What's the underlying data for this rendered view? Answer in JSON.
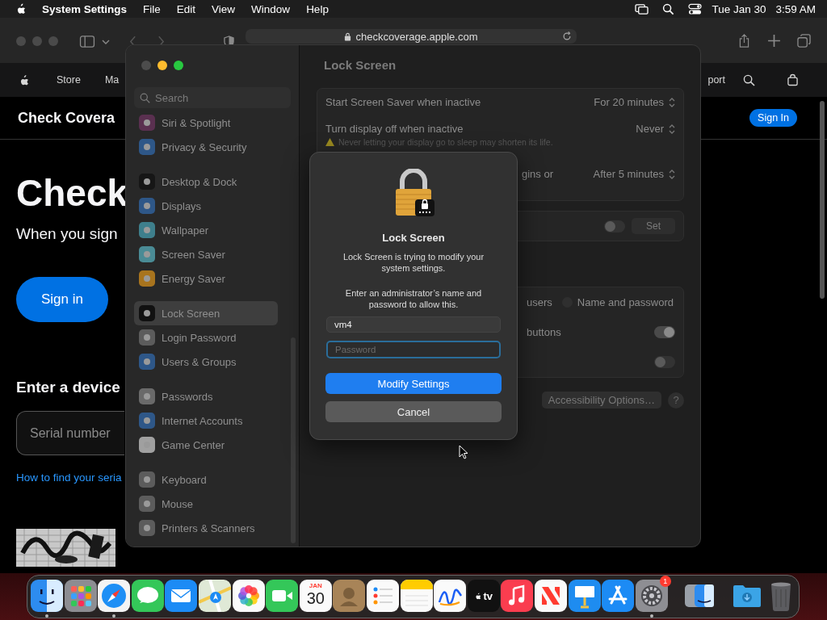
{
  "menubar": {
    "app": "System Settings",
    "menus": [
      "File",
      "Edit",
      "View",
      "Window",
      "Help"
    ],
    "date": "Tue Jan 30",
    "time": "3:59 AM"
  },
  "safari": {
    "url": "checkcoverage.apple.com",
    "nav": [
      "Store",
      "Ma"
    ],
    "nav_right": "port",
    "page": {
      "header": "Check Covera",
      "sign_in_button": "Sign In",
      "heading": "Check",
      "subtitle": "When you sign",
      "sign_in": "Sign in",
      "device_heading": "Enter a device",
      "serial_placeholder": "Serial number",
      "help_link": "How to find your seria"
    }
  },
  "settings": {
    "search_placeholder": "Search",
    "sidebar": [
      {
        "items": [
          {
            "label": "Siri & Spotlight",
            "color": "#5a3050",
            "selected": false
          },
          {
            "label": "Privacy & Security",
            "color": "#2e5788",
            "selected": false
          }
        ]
      },
      {
        "items": [
          {
            "label": "Desktop & Dock",
            "color": "#161616",
            "selected": false
          },
          {
            "label": "Displays",
            "color": "#2e5788",
            "selected": false
          },
          {
            "label": "Wallpaper",
            "color": "#3e7f8c",
            "selected": false
          },
          {
            "label": "Screen Saver",
            "color": "#4a8b95",
            "selected": false
          },
          {
            "label": "Energy Saver",
            "color": "#a8741e",
            "selected": false
          }
        ]
      },
      {
        "items": [
          {
            "label": "Lock Screen",
            "color": "#111111",
            "selected": true
          },
          {
            "label": "Login Password",
            "color": "#5c5c5c",
            "selected": false
          },
          {
            "label": "Users & Groups",
            "color": "#2e5788",
            "selected": false
          }
        ]
      },
      {
        "items": [
          {
            "label": "Passwords",
            "color": "#6a6a6a",
            "selected": false
          },
          {
            "label": "Internet Accounts",
            "color": "#2e5788",
            "selected": false
          },
          {
            "label": "Game Center",
            "color": "#a0a0a0",
            "selected": false
          }
        ]
      },
      {
        "items": [
          {
            "label": "Keyboard",
            "color": "#5c5c5c",
            "selected": false
          },
          {
            "label": "Mouse",
            "color": "#5c5c5c",
            "selected": false
          },
          {
            "label": "Printers & Scanners",
            "color": "#5c5c5c",
            "selected": false
          }
        ]
      }
    ],
    "content": {
      "title": "Lock Screen",
      "group_1": [
        {
          "label": "Start Screen Saver when inactive",
          "value": "For 20 minutes"
        },
        {
          "label": "Turn display off when inactive",
          "value": "Never",
          "warning": "Never letting your display go to sleep may shorten its life."
        },
        {
          "label": "gins or",
          "value": "After 5 minutes"
        }
      ],
      "group_2": {
        "on": false,
        "button": "Set"
      },
      "group_3": {
        "label": "users",
        "radio_label": "Name and password",
        "radio_selected": false,
        "rows": [
          {
            "label": "buttons",
            "on": true
          },
          {
            "on": false
          }
        ]
      },
      "accessibility_button": "Accessibility Options…",
      "help_button": "?"
    }
  },
  "dialog": {
    "title": "Lock Screen",
    "message": "Lock Screen is trying to modify your system settings.",
    "prompt": "Enter an administrator’s name and password to allow this.",
    "name_value": "vm4",
    "password_placeholder": "Password",
    "password_focused": true,
    "buttons": [
      {
        "label": "Modify Settings",
        "default": true
      },
      {
        "label": "Cancel",
        "default": false
      }
    ]
  },
  "dock": {
    "apps": [
      {
        "kind": "finder",
        "running": true
      },
      {
        "kind": "launchpad",
        "running": false
      },
      {
        "kind": "safari",
        "running": true
      },
      {
        "kind": "messages",
        "running": false
      },
      {
        "kind": "mail",
        "running": false
      },
      {
        "kind": "maps",
        "running": false
      },
      {
        "kind": "photos",
        "running": false
      },
      {
        "kind": "facetime",
        "running": false
      },
      {
        "kind": "calendar",
        "running": false,
        "month": "JAN",
        "day": "30"
      },
      {
        "kind": "contacts",
        "running": false
      },
      {
        "kind": "reminders",
        "running": false
      },
      {
        "kind": "notes",
        "running": false
      },
      {
        "kind": "freeform",
        "running": false
      },
      {
        "kind": "tv",
        "running": false,
        "label": "tv"
      },
      {
        "kind": "music",
        "running": false
      },
      {
        "kind": "news",
        "running": false
      },
      {
        "kind": "keynote",
        "running": false
      },
      {
        "kind": "appstore",
        "running": false
      },
      {
        "kind": "settings",
        "running": true,
        "badge": "1"
      }
    ],
    "utilities": [
      {
        "kind": "migration",
        "running": false
      }
    ],
    "others": [
      {
        "kind": "folder",
        "running": false
      },
      {
        "kind": "trash",
        "running": false
      }
    ]
  }
}
